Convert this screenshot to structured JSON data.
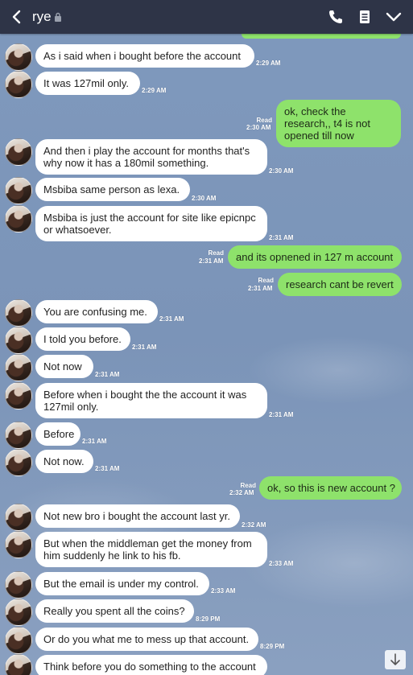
{
  "header": {
    "title": "rye"
  },
  "messages": [
    {
      "text": "As i said when i bought before the account",
      "time": "2:29 AM"
    },
    {
      "text": "It was 127mil only.",
      "time": "2:29 AM"
    },
    {
      "text": "ok, check the research,, t4 is not opened till now",
      "read": "Read",
      "time": "2:30 AM"
    },
    {
      "text": "And then i play the account for months that's why now it has a 180mil something.",
      "time": "2:30 AM"
    },
    {
      "text": "Msbiba same person as lexa.",
      "time": "2:30 AM"
    },
    {
      "text": "Msbiba is just the account for site like epicnpc or whatsoever.",
      "time": "2:31 AM"
    },
    {
      "text": "and its opnened in 127 m account",
      "read": "Read",
      "time": "2:31 AM"
    },
    {
      "text": "research cant be revert",
      "read": "Read",
      "time": "2:31 AM"
    },
    {
      "text": "You are confusing me.",
      "time": "2:31 AM"
    },
    {
      "text": "I told you before.",
      "time": "2:31 AM"
    },
    {
      "text": "Not now",
      "time": "2:31 AM"
    },
    {
      "text": "Before when i bought the the account it was 127mil only.",
      "time": "2:31 AM"
    },
    {
      "text": "Before",
      "time": "2:31 AM"
    },
    {
      "text": "Not now.",
      "time": "2:31 AM"
    },
    {
      "text": "ok, so this is new account ?",
      "read": "Read",
      "time": "2:32 AM"
    },
    {
      "text": "Not new bro i bought the account last yr.",
      "time": "2:32 AM"
    },
    {
      "text": "But when the middleman get the money from him suddenly he link to his fb.",
      "time": "2:33 AM"
    },
    {
      "text": "But the email is under my control.",
      "time": "2:33 AM"
    },
    {
      "text": "Really you spent all the coins?",
      "time": "8:29 PM"
    },
    {
      "text": "Or do you what me to mess up that account.",
      "time": "8:29 PM"
    },
    {
      "text": "Think before you do something to the account"
    }
  ]
}
